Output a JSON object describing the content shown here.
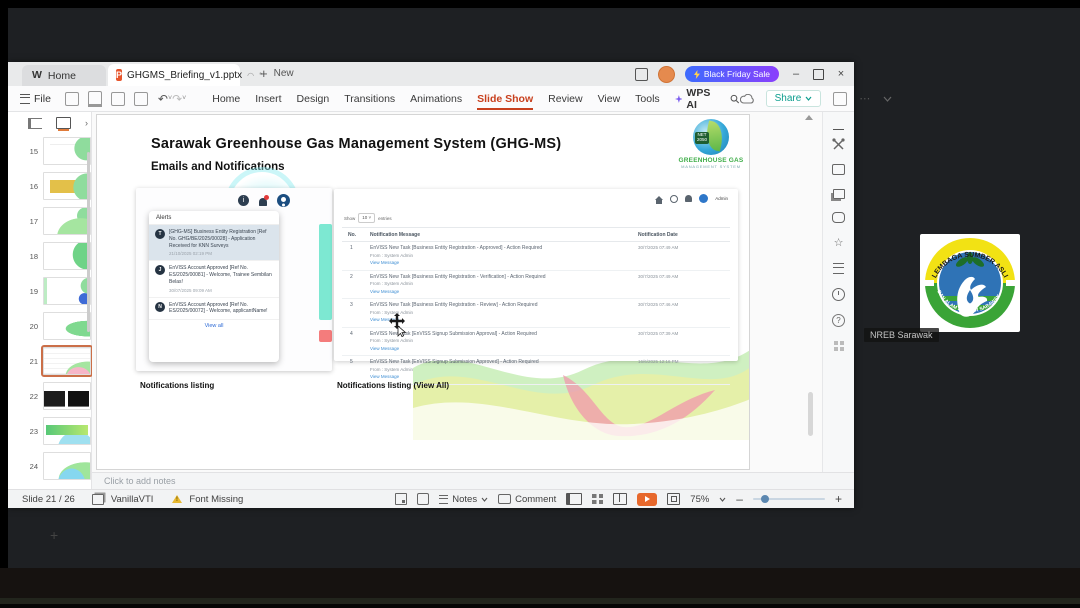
{
  "window": {
    "tabs": {
      "home": "Home",
      "doc": "GHGMS_Briefing_v1.pptx",
      "new_label": "New"
    },
    "promo": "Black Friday Sale",
    "file_menu": "File",
    "menus": [
      "Home",
      "Insert",
      "Design",
      "Transitions",
      "Animations",
      "Slide Show",
      "Review",
      "View",
      "Tools"
    ],
    "active_menu": "Slide Show",
    "wps_ai": "WPS AI",
    "share": "Share"
  },
  "slide_panel": {
    "slides": [
      {
        "num": "15"
      },
      {
        "num": "16"
      },
      {
        "num": "17"
      },
      {
        "num": "18"
      },
      {
        "num": "19"
      },
      {
        "num": "20"
      },
      {
        "num": "21"
      },
      {
        "num": "22"
      },
      {
        "num": "23"
      },
      {
        "num": "24"
      }
    ],
    "selected": "21"
  },
  "slide": {
    "title": "Sarawak Greenhouse Gas Management System (GHG-MS)",
    "subtitle": "Emails and Notifications",
    "logo": {
      "badge_line1": "NET",
      "badge_line2": "2050",
      "line1": "GREENHOUSE GAS",
      "line2": "MANAGEMENT SYSTEM"
    },
    "alerts": {
      "header": "Alerts",
      "items": [
        {
          "initial": "T",
          "text": "[GHG-MS] Business Entity Registration [Ref No. GHG/BE/2025/00028] - Application Received for KNN Surveys",
          "time": "21/10/2025 02:19 PM"
        },
        {
          "initial": "J",
          "text": "EnVISS Account Approved [Ref No. ES/2025/00081] - Welcome, Trainee Sembilan Belas!",
          "time": "30/07/2025 09:09 AM"
        },
        {
          "initial": "N",
          "text": "EnVISS Account Approved [Ref No. ES/2025/00072] - Welcome, applicantName!",
          "time": ""
        }
      ],
      "view_all": "View all"
    },
    "portal": {
      "user": "Admin",
      "show_label": "Show",
      "show_value": "10",
      "entries_label": "entries",
      "columns": {
        "no": "No.",
        "message": "Notification Message",
        "date": "Notification Date"
      },
      "from_line": "From : System Admin",
      "link_label": "View Message",
      "rows": [
        {
          "no": "1",
          "message": "EnVISS New Task [Business Entity Registration - Approved] - Action Required",
          "date": "30/7/2025 07:49 AM"
        },
        {
          "no": "2",
          "message": "EnVISS New Task [Business Entity Registration - Verification] - Action Required",
          "date": "30/7/2025 07:49 AM"
        },
        {
          "no": "3",
          "message": "EnVISS New Task [Business Entity Registration - Review] - Action Required",
          "date": "30/7/2025 07:46 AM"
        },
        {
          "no": "4",
          "message": "EnVISS New Task [EnVISS Signup Submission Approval] - Action Required",
          "date": "30/7/2025 07:39 AM"
        },
        {
          "no": "5",
          "message": "EnVISS New Task [EnVISS Signup Submission Approved] - Action Required",
          "date": "16/6/2025 12:16 PM"
        }
      ]
    },
    "captions": {
      "left": "Notifications listing",
      "right": "Notifications listing (View All)"
    }
  },
  "notes_placeholder": "Click to add notes",
  "statusbar": {
    "slide_info": "Slide 21 / 26",
    "theme": "VanillaVTI",
    "font_missing": "Font Missing",
    "notes_label": "Notes",
    "comment_label": "Comment",
    "zoom": "75%"
  },
  "participant": {
    "label": "NREB Sarawak",
    "logo_arc_top": "LEMBAGA SUMBER ASLI",
    "logo_arc_bottom": "DAN ALAM SEKITAR SARAWAK"
  },
  "colors": {
    "wps_accent": "#c8401e",
    "promo_gradient_start": "#3d6bfd",
    "promo_gradient_end": "#8a3ffc",
    "share_teal": "#0c9e8e",
    "alert_highlight": "#dbe4ec",
    "link_blue": "#3f8fd4",
    "teal_bar": "#7de8d2",
    "red_bar": "#f47c7c",
    "play_orange": "#e7682c"
  }
}
